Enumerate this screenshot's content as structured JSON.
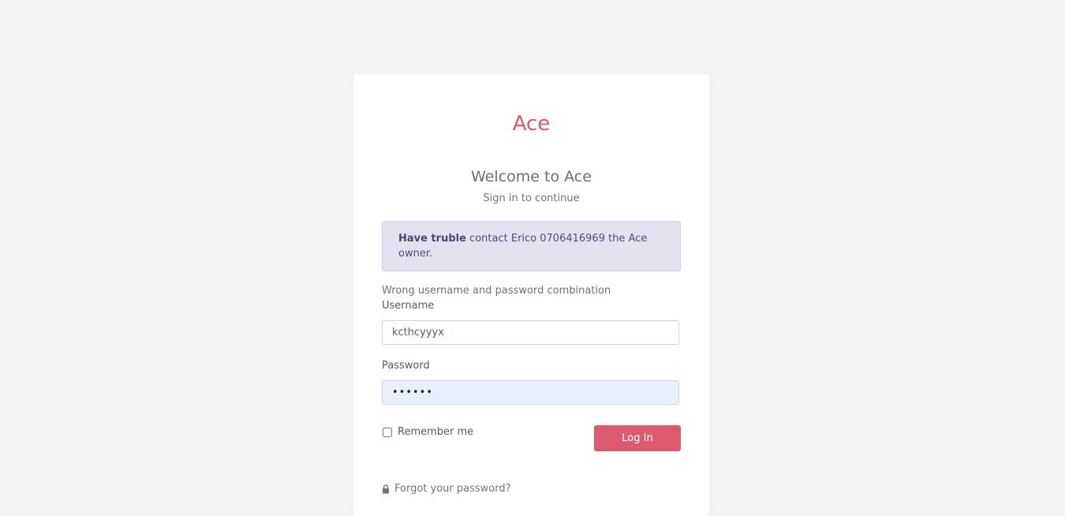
{
  "brand": {
    "name": "Ace",
    "accent": "#dc5a6e"
  },
  "header": {
    "welcome": "Welcome to Ace",
    "subtitle": "Sign in to continue"
  },
  "alert": {
    "strong": "Have truble",
    "message": " contact Erico 0706416969 the Ace owner."
  },
  "form": {
    "error": "Wrong username and password combination",
    "username_label": "Username",
    "username_value": "kcthcyyyx",
    "password_label": "Password",
    "password_value": "••••••",
    "remember_label": "Remember me",
    "remember_checked": false,
    "login_label": "Log In"
  },
  "footer": {
    "forgot_label": "Forgot your password?",
    "forgot_icon": "lock-icon"
  }
}
